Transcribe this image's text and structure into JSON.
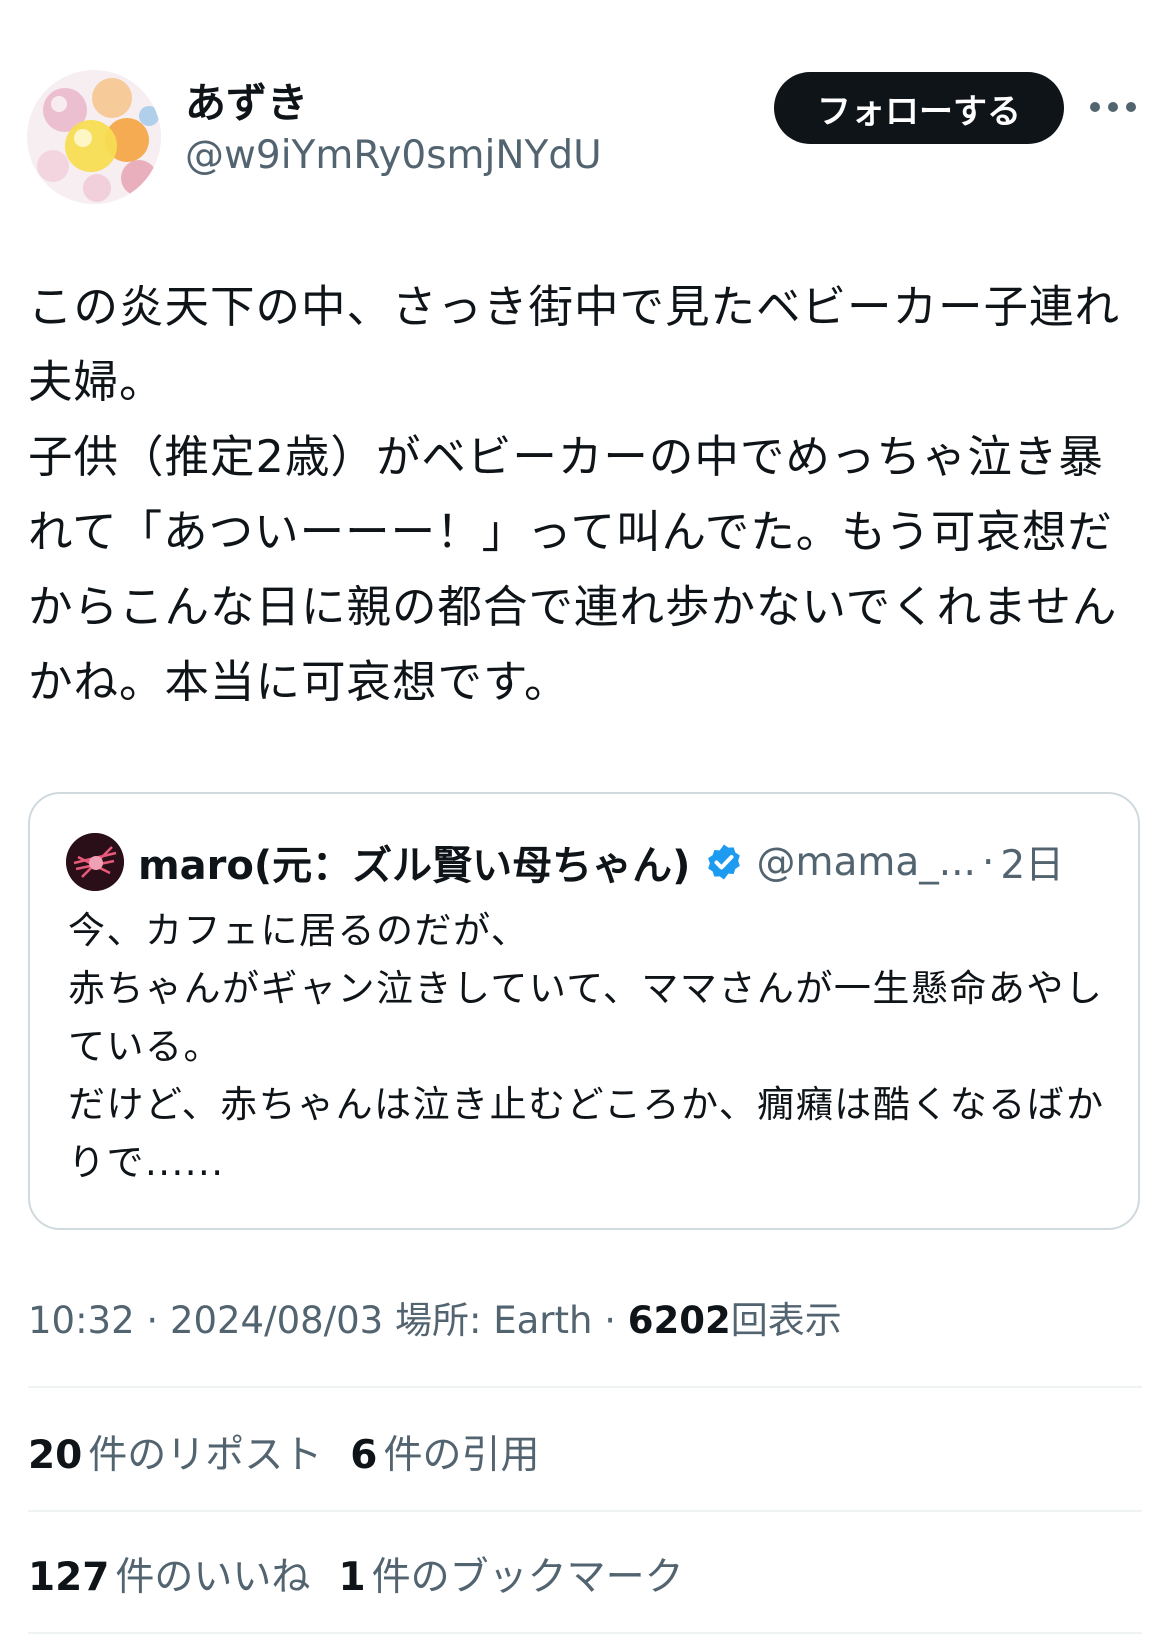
{
  "author": {
    "display_name": "あずき",
    "handle": "@w9iYmRy0smjNYdU",
    "avatar_icon": "candy-avatar-icon"
  },
  "header": {
    "follow_label": "フォローする",
    "more_icon": "more-options-icon"
  },
  "tweet": {
    "text": "この炎天下の中、さっき街中で見たベビーカー子連れ夫婦。\n子供（推定2歳）がベビーカーの中でめっちゃ泣き暴れて「あついーーー！」って叫んでた。もう可哀想だからこんな日に親の都合で連れ歩かないでくれませんかね。本当に可哀想です。"
  },
  "quote": {
    "name": "maro(元：ズル賢い母ちゃん)",
    "handle": "@mama_...",
    "separator": "·",
    "time": "2日",
    "text": "今、カフェに居るのだが、\n赤ちゃんがギャン泣きしていて、ママさんが一生懸命あやしている。\nだけど、赤ちゃんは泣き止むどころか、癇癪は酷くなるばかりで......",
    "verified_color": "#1d9bf0"
  },
  "meta": {
    "time": "10:32",
    "dot1": " · ",
    "date": "2024/08/03",
    "location_prefix": " 場所: ",
    "location": "Earth",
    "dot2": " · ",
    "views_count": "6202",
    "views_label": "回表示"
  },
  "stats": {
    "reposts": {
      "count": "20",
      "label": "件のリポスト"
    },
    "quotes": {
      "count": "6",
      "label": "件の引用"
    },
    "likes": {
      "count": "127",
      "label": "件のいいね"
    },
    "bookmarks": {
      "count": "1",
      "label": "件のブックマーク"
    }
  },
  "colors": {
    "text_primary": "#0f1419",
    "text_secondary": "#536471",
    "border": "#cfd9de",
    "divider": "#eff3f4",
    "follow_button_bg": "#0f1419"
  }
}
